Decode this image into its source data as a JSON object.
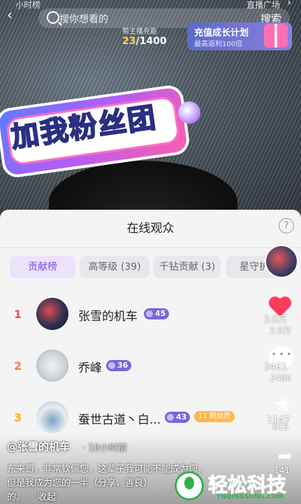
{
  "top": {
    "left_label": "小时榜",
    "right_label": "直播广场",
    "search_placeholder": "搜你想看的",
    "search_button": "搜索",
    "progress_label": "帮主播充能",
    "progress_current": "23",
    "progress_total": "/1400",
    "promo_title": "充值成长计划",
    "promo_sub": "最高返利100倍"
  },
  "sticker": {
    "text": "加我粉丝团"
  },
  "sheet": {
    "title": "在线观众",
    "tabs": [
      {
        "label": "贡献榜"
      },
      {
        "label": "高等级 (39)"
      },
      {
        "label": "千钻贡献 (3)"
      },
      {
        "label": "星守护"
      }
    ],
    "rows": [
      {
        "rank": "1",
        "name": "张雪的机车",
        "level": "45",
        "amount": "3.0万",
        "rank_color": "#ff4d4f"
      },
      {
        "rank": "2",
        "name": "乔峰",
        "level": "36",
        "amount": "2461",
        "rank_color": "#ff7a45"
      },
      {
        "rank": "3",
        "name": "蚕世古道丶白...",
        "level": "43",
        "fan_badge": "11 粉丝团",
        "amount": "1147",
        "rank_color": "#ffb000"
      }
    ]
  },
  "side": {
    "like_count": "2.9万",
    "comment_count": "2480",
    "star_count": "615",
    "share_count": "141"
  },
  "caption": {
    "author": "@张雪的机车",
    "time": "· 10小时前",
    "line1": "东来哥，非常钦佩您，这辈子我可能不能成为您，",
    "line2": "但是我成为您的一半（分享，善良）",
    "line3": "的。",
    "collapse": "收起"
  },
  "watermark": {
    "title": "轻松科技",
    "sub": "YNQINGSONG.COM"
  }
}
